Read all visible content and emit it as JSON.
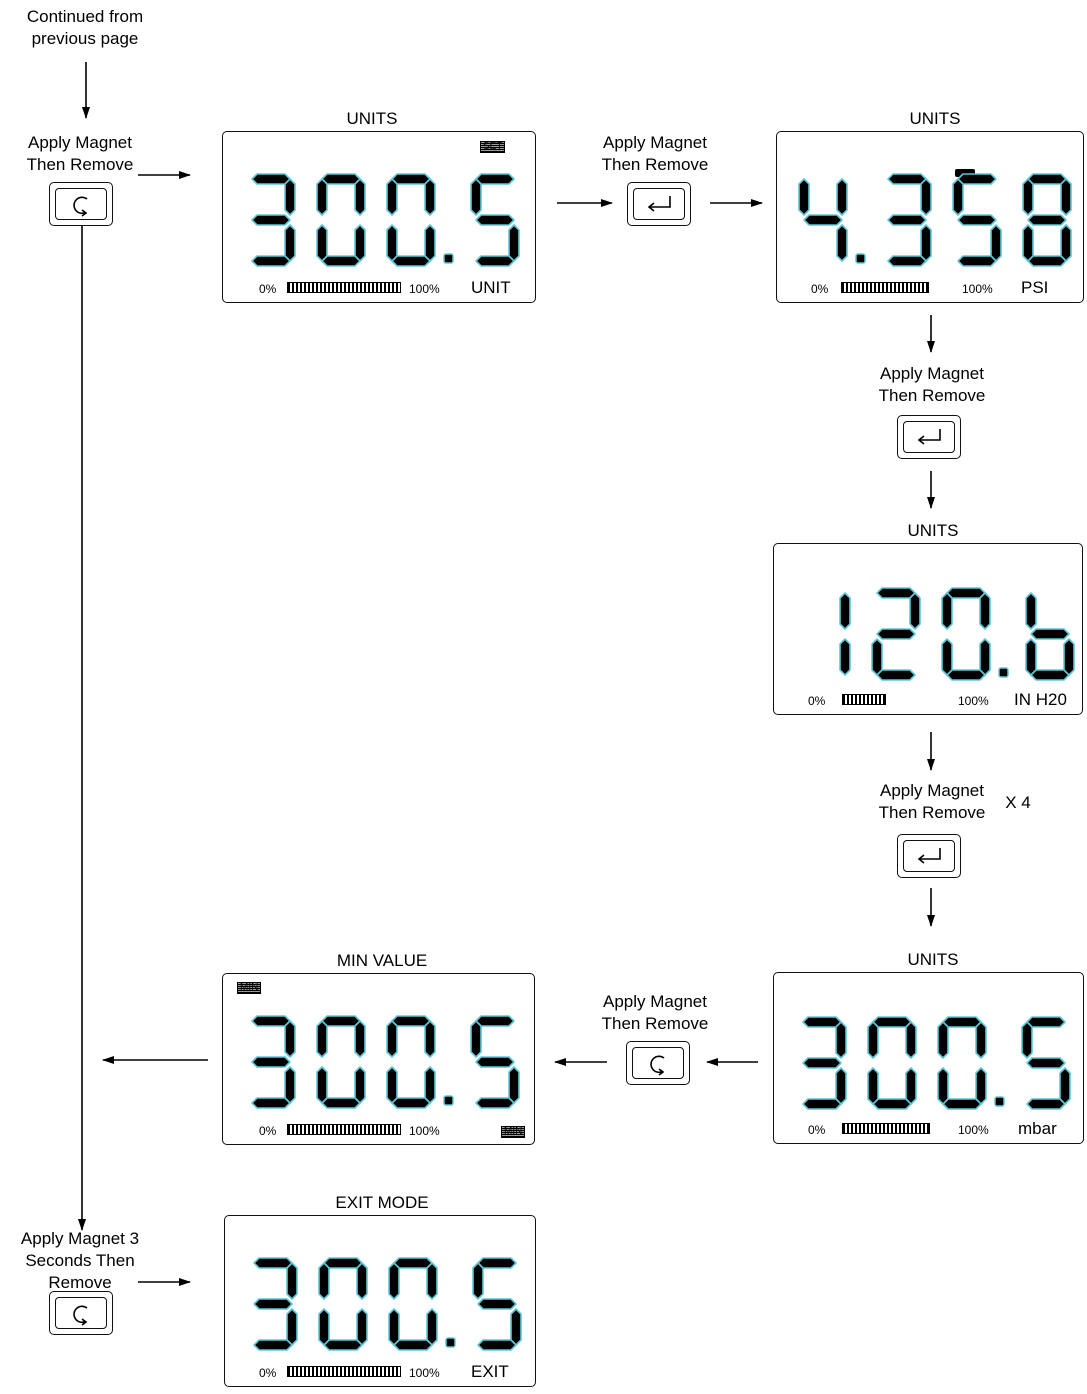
{
  "start_note": "Continued from\nprevious page",
  "apply_magnet": "Apply Magnet\nThen Remove",
  "apply_magnet_3s": "Apply Magnet 3\nSeconds Then\nRemove",
  "repeat_label": "X 4",
  "scale_min": "0%",
  "scale_max": "100%",
  "indicator_set": "SET",
  "indicator_min": "MIN",
  "icons": {
    "mode_key": "rotate-arrow-icon",
    "enter_key": "enter-return-icon"
  },
  "panels": {
    "units_unit": {
      "title": "UNITS",
      "display": "300.5",
      "unit": "UNIT",
      "bar_level": 1.0
    },
    "units_psi": {
      "title": "UNITS",
      "display": "4.358",
      "unit": "PSI",
      "bar_level": 1.0
    },
    "units_inh2o": {
      "title": "UNITS",
      "display": "120.b",
      "unit": "IN H20",
      "bar_level": 0.35
    },
    "units_mbar": {
      "title": "UNITS",
      "display": "300.5",
      "unit": "mbar",
      "bar_level": 1.0
    },
    "min_value": {
      "title": "MIN VALUE",
      "display": "300.5",
      "unit": "",
      "bar_level": 1.0
    },
    "exit_mode": {
      "title": "EXIT MODE",
      "display": "300.5",
      "unit": "EXIT",
      "bar_level": 1.0
    }
  },
  "colors": {
    "segment_fill": "#000000",
    "segment_glow": "#5ec8d8",
    "line": "#000000"
  }
}
